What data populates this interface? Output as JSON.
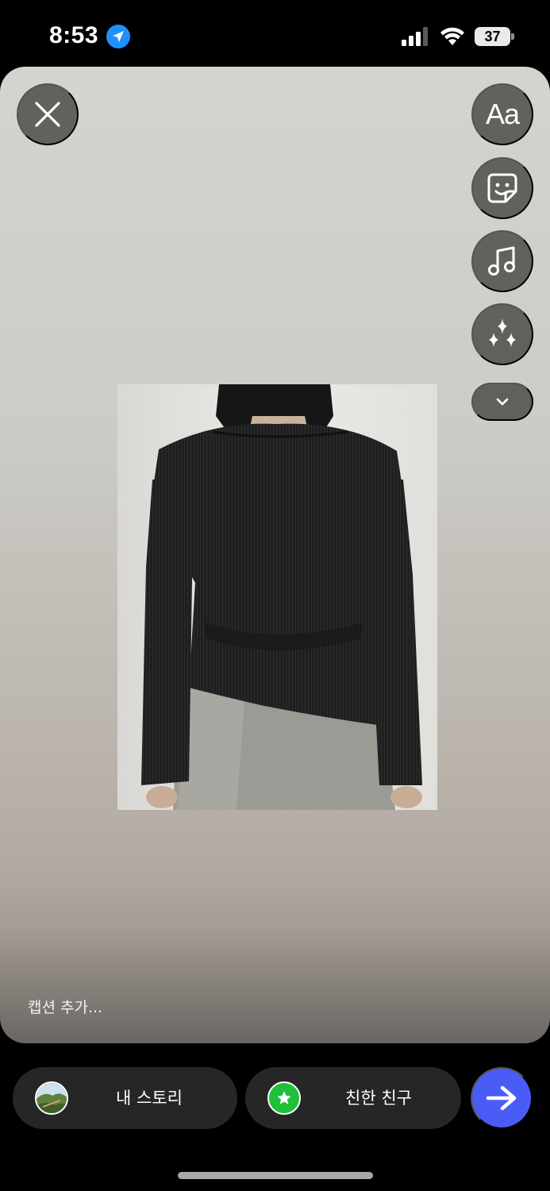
{
  "status_bar": {
    "time": "8:53",
    "battery": "37",
    "icons": [
      "location-arrow-icon",
      "cellular-signal-icon",
      "wifi-icon",
      "battery-icon"
    ]
  },
  "story_editor": {
    "close_icon": "close-icon",
    "tools": {
      "text_label": "Aa",
      "sticker_icon": "sticker-icon",
      "music_icon": "music-note-icon",
      "effects_icon": "sparkles-icon",
      "more_icon": "chevron-down-icon"
    },
    "caption_placeholder": "캡션 추가..."
  },
  "share_bar": {
    "my_story_label": "내 스토리",
    "close_friends_label": "친한 친구",
    "send_icon": "arrow-right-icon"
  },
  "colors": {
    "send_button": "#4a5cf6",
    "close_friends_green": "#1fbf3a",
    "location_blue": "#1e90ff",
    "pill_background": "#262626"
  }
}
